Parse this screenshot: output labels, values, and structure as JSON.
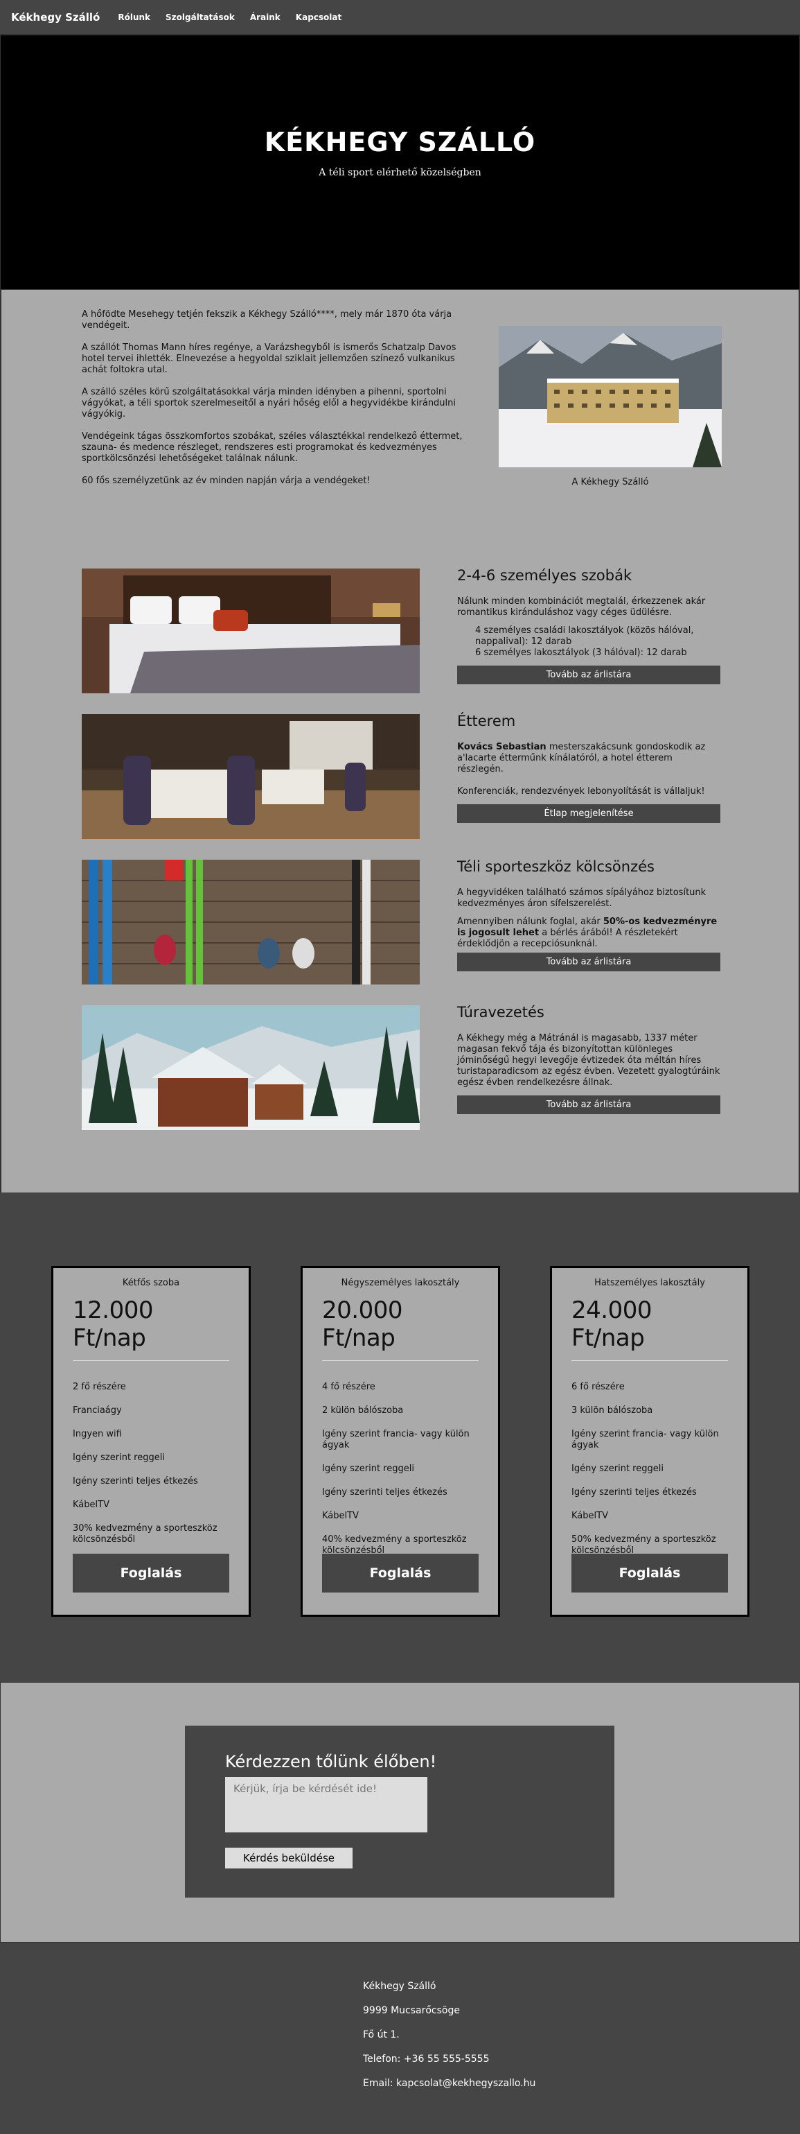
{
  "nav": {
    "brand": "Kékhegy Szálló",
    "links": [
      "Rólunk",
      "Szolgáltatások",
      "Áraink",
      "Kapcsolat"
    ]
  },
  "hero": {
    "title": "KÉKHEGY SZÁLLÓ",
    "subtitle": "A téli sport elérhető közelségben"
  },
  "intro": {
    "paragraphs": [
      "A hőfödte Mesehegy tetjén fekszik a Kékhegy Szálló****, mely már 1870 óta várja vendégeit.",
      "A szállót Thomas Mann híres regénye, a Varázshegyből is ismerős Schatzalp Davos hotel tervei ihlették. Elnevezése a hegyoldal sziklait jellemzően színező vulkanikus achát foltokra utal.",
      "A szálló széles körű szolgáltatásokkal várja minden idényben a pihenni, sportolni vágyókat, a téli sportok szerelmeseitől a nyári hőség elől a hegyvidékbe kirándulni vágyókig.",
      "Vendégeink tágas összkomfortos szobákat, széles választékkal rendelkező éttermet, szauna- és medence részleget, rendszeres esti programokat és kedvezményes sportkölcsönzési lehetőségeket találnak nálunk.",
      "60 fős személyzetünk az év minden napján várja a vendégeket!"
    ],
    "photo_caption": "A Kékhegy Szálló"
  },
  "services": {
    "rooms": {
      "title": "2-4-6 személyes szobák",
      "text": "Nálunk minden kombinációt megtalál, érkezzenek akár romantikus kiránduláshoz vagy céges üdülésre.",
      "items": [
        "4 személyes családi lakosztályok (közös hálóval, nappalival): 12 darab",
        "6 személyes lakosztályok (3 hálóval): 12 darab"
      ],
      "button": "Tovább az árlistára"
    },
    "restaurant": {
      "title": "Étterem",
      "chef": "Kovács Sebastian",
      "text": " mesterszakácsunk gondoskodik az a'lacarte étterműnk kínálatóról, a hotel étterem részlegén.",
      "text2": "Konferenciák, rendezvények lebonyolítását is vállaljuk!",
      "button": "Étlap megjelenítése"
    },
    "rental": {
      "title": "Téli sporteszköz kölcsönzés",
      "text": "A hegyvidéken található számos sípályához biztosítunk kedvezményes áron sífelszerelést.",
      "text2_a": "Amennyiben nálunk foglal, akár ",
      "text2_bold": "50%-os kedvezményre is jogosult lehet",
      "text2_b": " a bérlés árából! A részletekért érdeklődjön a recepciósunknál.",
      "button": "Tovább az árlistára"
    },
    "tours": {
      "title": "Túravezetés",
      "text": "A Kékhegy még a Mátránál is magasabb, 1337 méter magasan fekvő tája és bizonyítottan különleges jóminőségű hegyi levegője évtizedek óta méltán híres turistaparadicsom az egész évben. Vezetett gyalogtúráink egész évben rendelkezésre állnak.",
      "button": "Tovább az árlistára"
    }
  },
  "prices": [
    {
      "name": "Kétfős szoba",
      "price": "12.000 Ft/nap",
      "features": [
        "2 fő részére",
        "Franciaágy",
        "Ingyen wifi",
        "Igény szerint reggeli",
        "Igény szerinti teljes étkezés",
        "KábelTV",
        "30% kedvezmény a sporteszköz kölcsönzésből"
      ],
      "button": "Foglalás"
    },
    {
      "name": "Négyszemélyes lakosztály",
      "price": "20.000 Ft/nap",
      "features": [
        "4 fő részére",
        "2 külön bálószoba",
        "Igény szerint francia- vagy külön ágyak",
        "Igény szerint reggeli",
        "Igény szerinti teljes étkezés",
        "KábelTV",
        "40% kedvezmény a sporteszköz kölcsönzésből"
      ],
      "button": "Foglalás"
    },
    {
      "name": "Hatszemélyes lakosztály",
      "price": "24.000 Ft/nap",
      "features": [
        "6 fő részére",
        "3 külön bálószoba",
        "Igény szerint francia- vagy külön ágyak",
        "Igény szerint reggeli",
        "Igény szerinti teljes étkezés",
        "KábelTV",
        "50% kedvezmény a sporteszköz kölcsönzésből"
      ],
      "button": "Foglalás"
    }
  ],
  "contact": {
    "title": "Kérdezzen tőlünk élőben!",
    "placeholder": "Kérjük, írja be kérdését ide!",
    "button": "Kérdés beküldése"
  },
  "footer": {
    "lines": [
      "Kékhegy Szálló",
      "9999 Mucsarőcsöge",
      "Fő út 1.",
      "Telefon: +36 55 555-5555",
      "Email: kapcsolat@kekhegyszallo.hu"
    ]
  }
}
